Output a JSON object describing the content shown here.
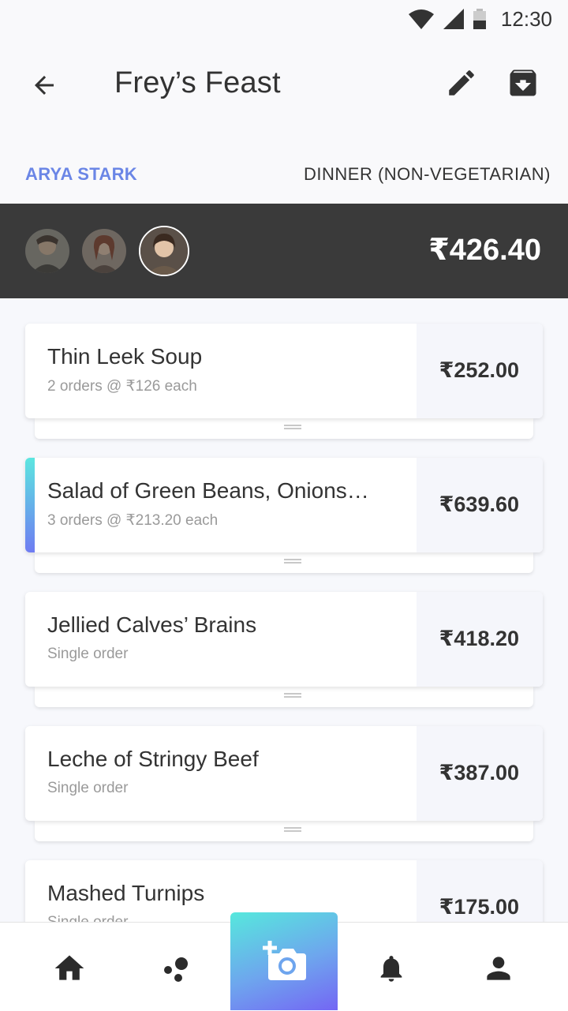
{
  "status_bar": {
    "time": "12:30"
  },
  "header": {
    "title": "Frey’s Feast"
  },
  "meta": {
    "user": "ARYA STARK",
    "meal_type": "DINNER (NON-VEGETARIAN)"
  },
  "summary": {
    "total": "₹426.40",
    "avatars": [
      "member-1",
      "member-2",
      "arya-stark"
    ]
  },
  "items": [
    {
      "name": "Thin Leek Soup",
      "detail": "2 orders @ ₹126 each",
      "price": "₹252.00"
    },
    {
      "name": "Salad of Green Beans, Onions…",
      "detail": "3 orders @ ₹213.20 each",
      "price": "₹639.60"
    },
    {
      "name": "Jellied Calves’ Brains",
      "detail": "Single order",
      "price": "₹418.20"
    },
    {
      "name": "Leche of Stringy Beef",
      "detail": "Single order",
      "price": "₹387.00"
    },
    {
      "name": "Mashed Turnips",
      "detail": "Single order",
      "price": "₹175.00"
    }
  ],
  "nav": {
    "items": [
      "home-icon",
      "groups-icon",
      "add-photo-icon",
      "bell-icon",
      "person-icon"
    ]
  },
  "colors": {
    "accent": "#6b86e6",
    "summary_bg": "#3a3a3a",
    "gradient_start": "#56e8dd",
    "gradient_end": "#7466f4"
  }
}
